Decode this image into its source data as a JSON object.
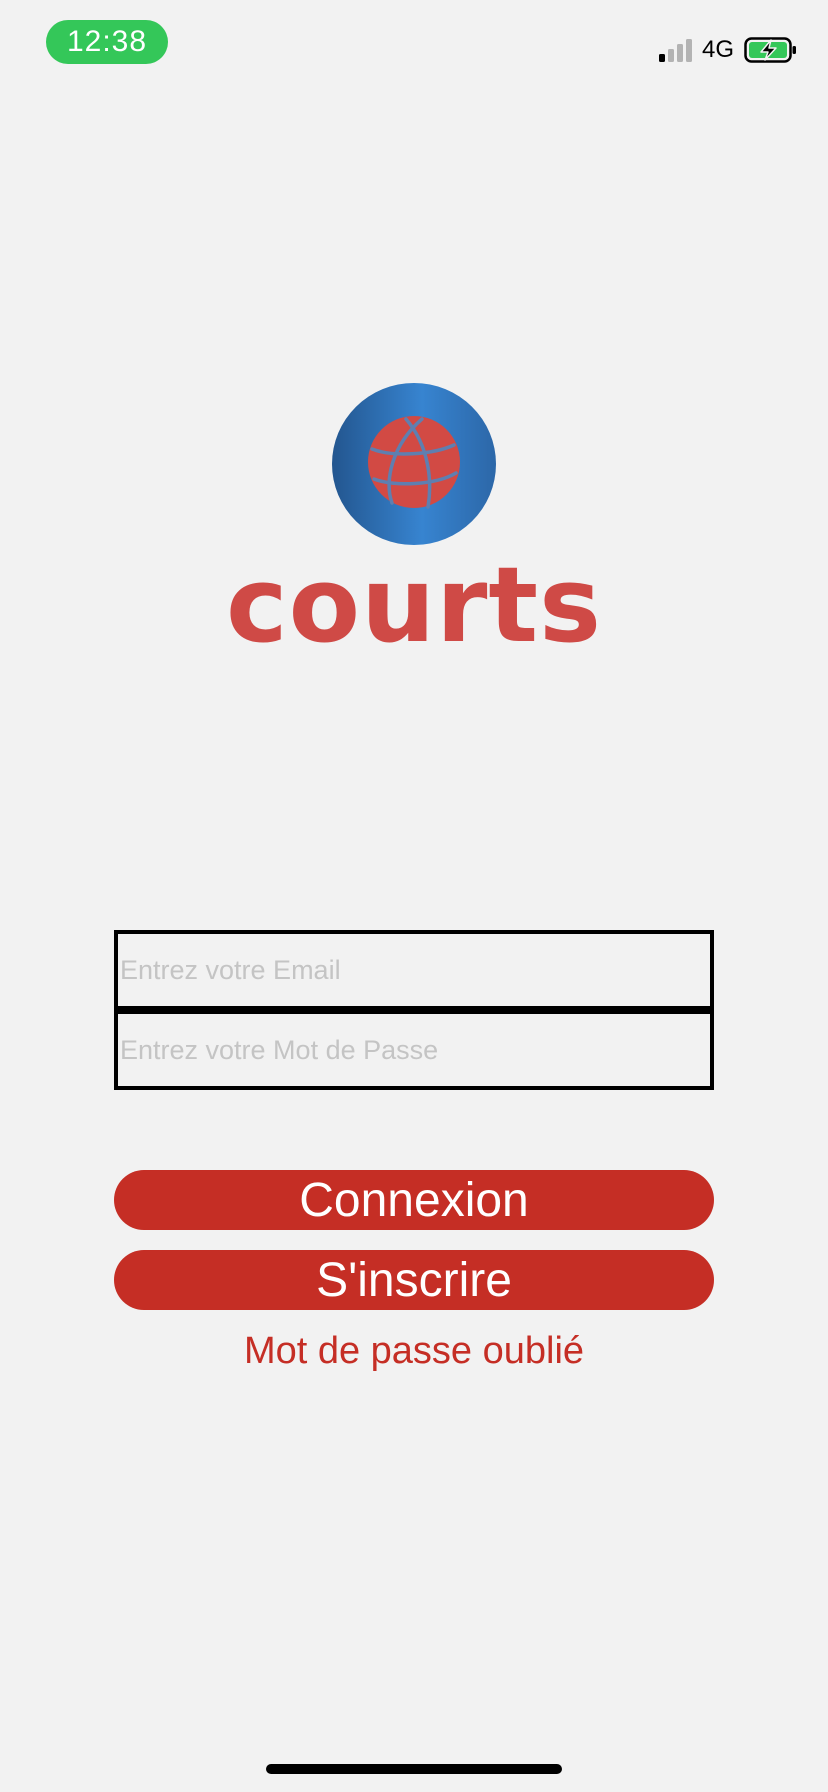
{
  "status_bar": {
    "time": "12:38",
    "network": "4G",
    "time_pill_color": "#34c759",
    "battery_state": "charging"
  },
  "logo": {
    "wordmark": "courts",
    "icon": "basketball-icon",
    "colors": {
      "circle": "#2f6fb3",
      "ball": "#d24a44",
      "wordmark": "#cf4a46"
    }
  },
  "form": {
    "email_placeholder": "Entrez votre Email",
    "email_value": "",
    "password_placeholder": "Entrez votre Mot de Passe",
    "password_value": ""
  },
  "actions": {
    "login_label": "Connexion",
    "signup_label": "S'inscrire",
    "forgot_label": "Mot de passe oublié",
    "accent": "#c52e25"
  }
}
